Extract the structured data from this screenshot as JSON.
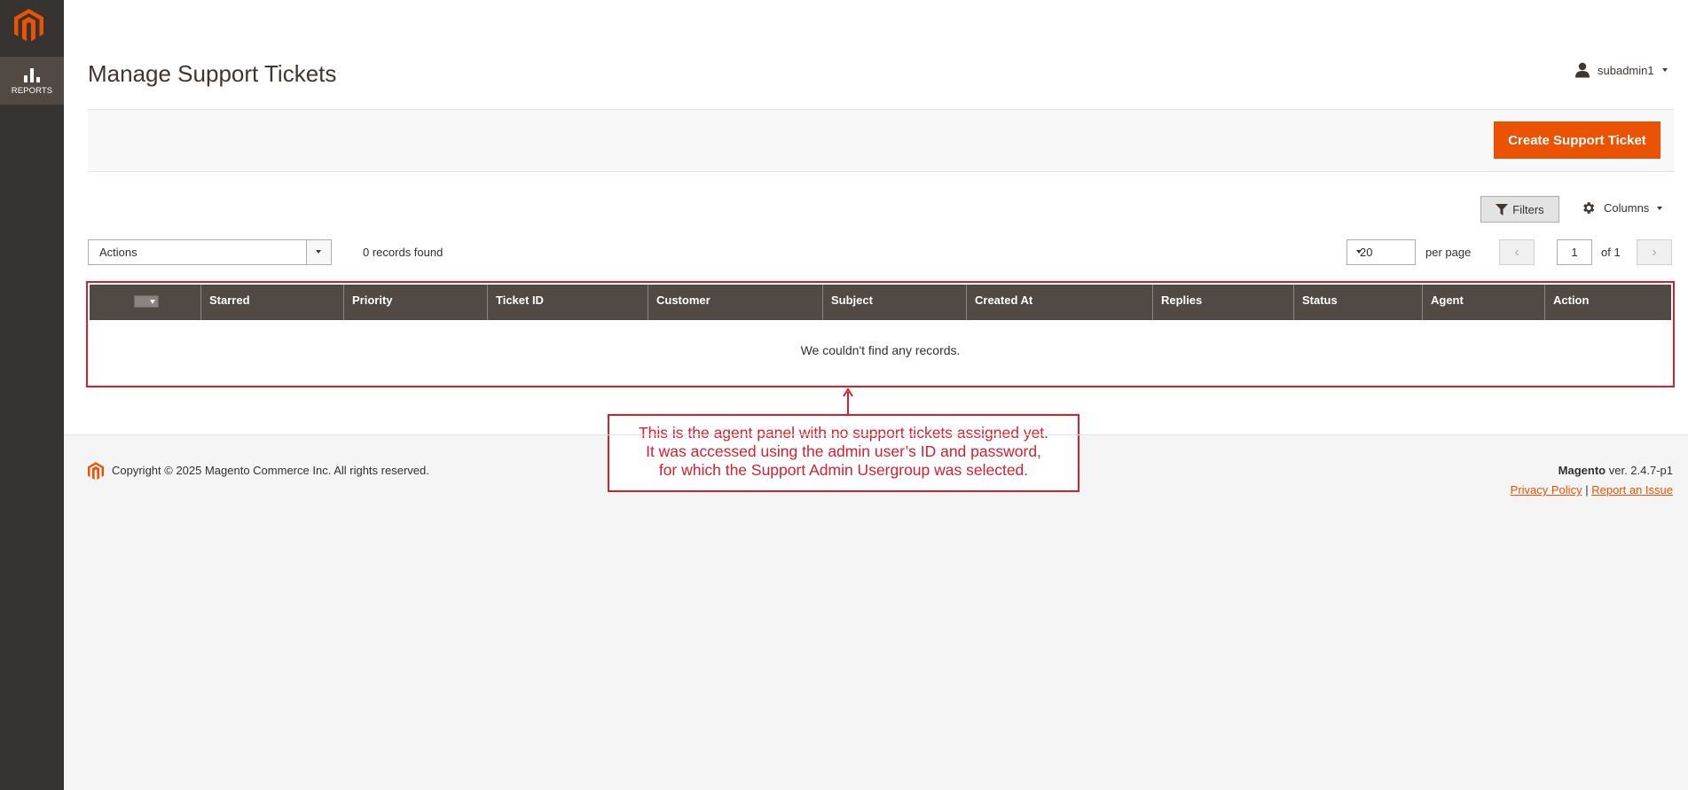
{
  "sidebar": {
    "items": [
      {
        "label": "REPORTS",
        "icon": "bar-chart-icon"
      }
    ]
  },
  "header": {
    "title": "Manage Support Tickets",
    "user": "subadmin1"
  },
  "toolbar": {
    "create_label": "Create Support Ticket",
    "filters_label": "Filters",
    "columns_label": "Columns"
  },
  "grid_controls": {
    "actions_value": "Actions",
    "records_found": "0 records found",
    "per_page_value": "20",
    "per_page_label": "per page",
    "current_page": "1",
    "of_pages": "of 1"
  },
  "grid": {
    "columns": [
      "Starred",
      "Priority",
      "Ticket ID",
      "Customer",
      "Subject",
      "Created At",
      "Replies",
      "Status",
      "Agent",
      "Action"
    ],
    "empty_message": "We couldn't find any records."
  },
  "annotation": {
    "lines": [
      "This is the agent panel with no support tickets assigned yet.",
      "It was accessed using the admin user’s ID and password,",
      "for which the Support Admin Usergroup was selected."
    ]
  },
  "footer": {
    "copyright": "Copyright © 2025 Magento Commerce Inc. All rights reserved.",
    "brand": "Magento",
    "version": " ver. 2.4.7-p1",
    "privacy": "Privacy Policy",
    "separator": "|",
    "report": "Report an Issue"
  },
  "colors": {
    "accent": "#eb5202",
    "sidebar": "#373330",
    "grid_header": "#514943",
    "annotation": "#d4212f"
  }
}
